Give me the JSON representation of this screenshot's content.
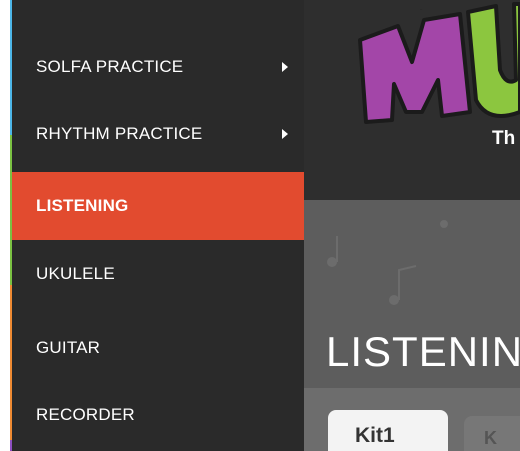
{
  "sidebar": {
    "items": [
      {
        "label": "SOLFA PRACTICE",
        "has_submenu": true,
        "strip_color": "#4db6e8"
      },
      {
        "label": "RHYTHM PRACTICE",
        "has_submenu": true,
        "strip_color": "#7ac142"
      },
      {
        "label": "LISTENING",
        "active": true,
        "strip_color": "#7ac142"
      },
      {
        "label": "UKULELE",
        "strip_color": "#7ac142"
      },
      {
        "label": "GUITAR",
        "strip_color": "#ee8a33"
      },
      {
        "label": "RECORDER",
        "strip_color": "#ee8a33"
      }
    ]
  },
  "header": {
    "logo": "MUS",
    "tagline": "Th"
  },
  "main": {
    "title": "LISTENIN",
    "tabs": [
      {
        "label": "Kit1",
        "active": true
      },
      {
        "label": "K"
      }
    ]
  },
  "colors": {
    "sidebar_bg": "#2a2a2a",
    "active_bg": "#e24b2f",
    "header_bg": "#2e2e2e",
    "content_bg": "#5d5d5d",
    "logo_purple": "#a346a8",
    "logo_green": "#8cc63f"
  }
}
